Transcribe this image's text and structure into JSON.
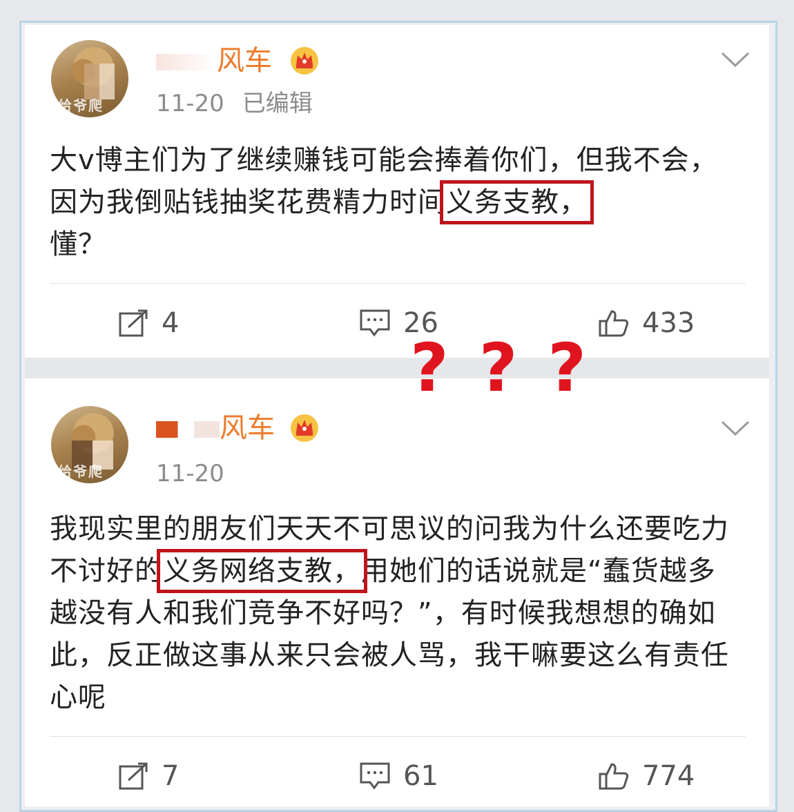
{
  "posts": [
    {
      "username_suffix": "风车",
      "date": "11-20",
      "edited": "已编辑",
      "avatar_watermark": "给爷爬",
      "text": {
        "pre": "大v博主们为了继续赚钱可能会捧着你们，但我不会，因为我倒贴钱抽奖花费精力时间",
        "highlight": "义务支教，",
        "post": "懂？"
      },
      "actions": {
        "repost": "4",
        "comment": "26",
        "like": "433"
      }
    },
    {
      "username_suffix": "风车",
      "date": "11-20",
      "avatar_watermark": "给爷爬",
      "text": {
        "pre": "我现实里的朋友们天天不可思议的问我为什么还要吃力不讨好的",
        "highlight": "义务网络支教，",
        "post": "用她们的话说就是“蠢货越多越没有人和我们竞争不好吗？”，有时候我想想的确如此，反正做这事从来只会被人骂，我干嘛要这么有责任心呢"
      },
      "actions": {
        "repost": "7",
        "comment": "61",
        "like": "774"
      }
    }
  ],
  "overlay": {
    "question_marks": [
      "?",
      "?",
      "?"
    ]
  },
  "colors": {
    "username": "#ee7b2b",
    "highlight_box": "#c0141b",
    "question_mark": "#e0141e"
  },
  "icons": [
    "crown-badge-icon",
    "chevron-down-icon",
    "repost-icon",
    "comment-icon",
    "like-icon"
  ]
}
